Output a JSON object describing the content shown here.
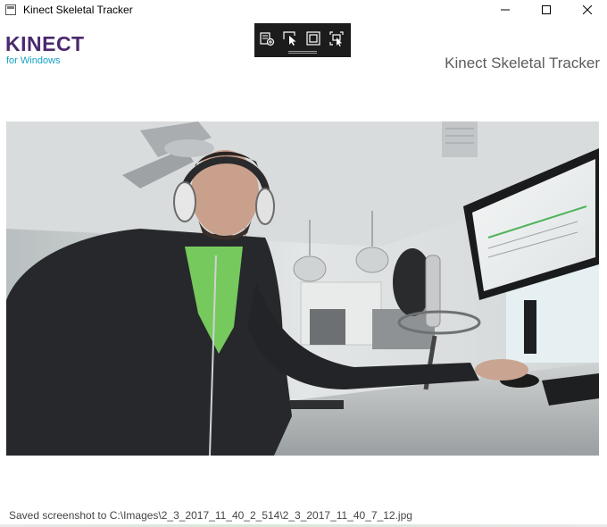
{
  "window": {
    "title": "Kinect Skeletal Tracker",
    "minimize_icon": "minimize-icon",
    "maximize_icon": "maximize-icon",
    "close_icon": "close-icon"
  },
  "header": {
    "logo_main": "KINECT",
    "logo_sub": "for Windows",
    "app_title": "Kinect Skeletal Tracker",
    "colors": {
      "logo": "#4b2a6e",
      "logo_sub": "#17a2c6",
      "toolbar_bg": "#1c1c1c"
    }
  },
  "toolbar": {
    "buttons": [
      {
        "icon": "add-ui-element-icon"
      },
      {
        "icon": "select-element-icon"
      },
      {
        "icon": "display-layout-adorners-icon"
      },
      {
        "icon": "track-focused-element-icon"
      }
    ]
  },
  "video": {
    "content": "camera-feed"
  },
  "status": {
    "message": "Saved screenshot to C:\\Images\\2_3_2017_11_40_2_514\\2_3_2017_11_40_7_12.jpg"
  }
}
